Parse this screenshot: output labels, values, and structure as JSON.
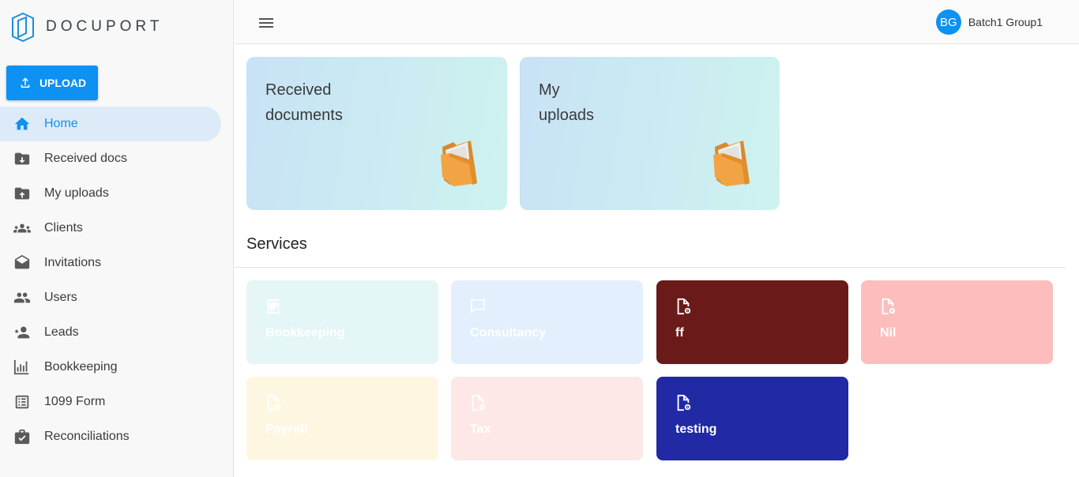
{
  "app": {
    "logo_text": "DOCUPORT"
  },
  "upload": {
    "label": "UPLOAD"
  },
  "sidebar": {
    "items": [
      {
        "label": "Home",
        "icon": "home-icon",
        "active": true
      },
      {
        "label": "Received docs",
        "icon": "folder-download-icon"
      },
      {
        "label": "My uploads",
        "icon": "folder-upload-icon"
      },
      {
        "label": "Clients",
        "icon": "group-icon"
      },
      {
        "label": "Invitations",
        "icon": "envelope-open-icon"
      },
      {
        "label": "Users",
        "icon": "people-icon"
      },
      {
        "label": "Leads",
        "icon": "person-star-icon"
      },
      {
        "label": "Bookkeeping",
        "icon": "chart-icon"
      },
      {
        "label": "1099 Form",
        "icon": "list-icon"
      },
      {
        "label": "Reconciliations",
        "icon": "briefcase-check-icon"
      }
    ]
  },
  "header": {
    "user": {
      "initials": "BG",
      "name": "Batch1 Group1"
    }
  },
  "cards": {
    "received": {
      "line1": "Received",
      "line2": "documents"
    },
    "uploads": {
      "line1": "My",
      "line2": "uploads"
    }
  },
  "services": {
    "title": "Services",
    "items": [
      {
        "label": "Bookkeeping",
        "bg": "#e4f6f5",
        "icon": "receipt-icon"
      },
      {
        "label": "Consultancy",
        "bg": "#e3effc",
        "icon": "chat-icon"
      },
      {
        "label": "ff",
        "bg": "#6b1a1a",
        "icon": "doc-gear-icon"
      },
      {
        "label": "Nil",
        "bg": "#fcbdbc",
        "icon": "doc-gear-icon"
      },
      {
        "label": "Payroll",
        "bg": "#fdf7e1",
        "icon": "doc-gear-icon"
      },
      {
        "label": "Tax",
        "bg": "#fde8e7",
        "icon": "doc-gear-icon"
      },
      {
        "label": "testing",
        "bg": "#2129a4",
        "icon": "doc-gear-icon"
      }
    ]
  },
  "colors": {
    "accent": "#0d91f2",
    "active_bg": "#ddebf8"
  }
}
